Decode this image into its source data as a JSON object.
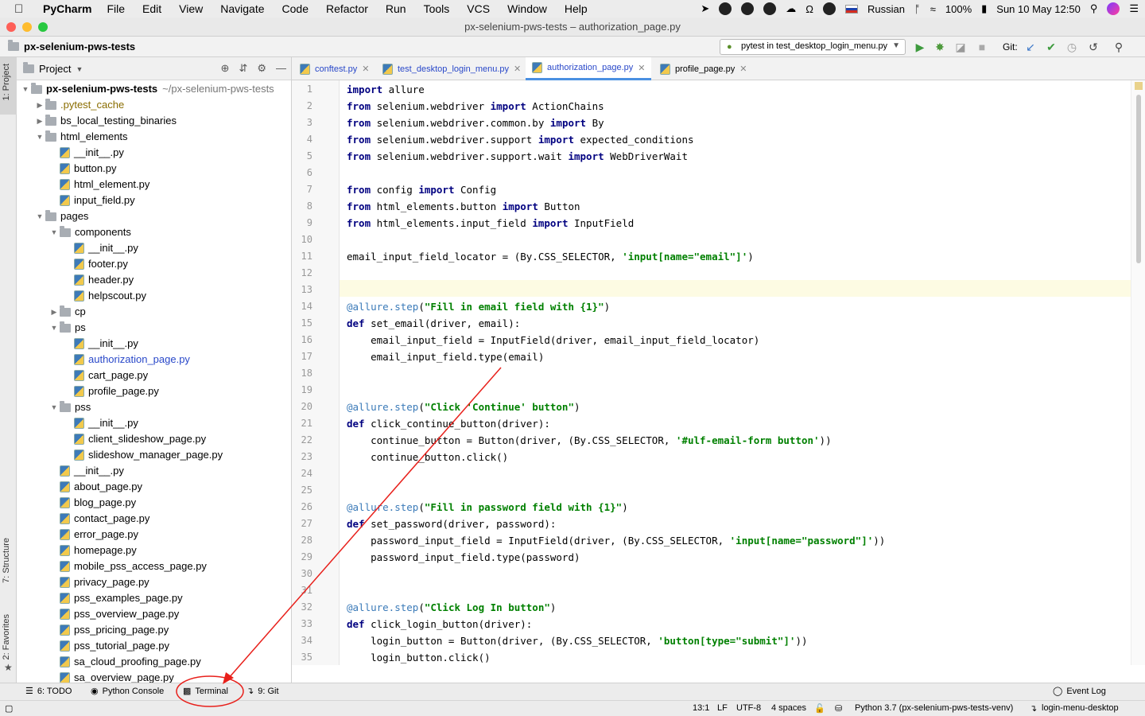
{
  "menubar": {
    "app": "PyCharm",
    "items": [
      "File",
      "Edit",
      "View",
      "Navigate",
      "Code",
      "Refactor",
      "Run",
      "Tools",
      "VCS",
      "Window",
      "Help"
    ],
    "input_source": "Russian",
    "battery": "100%",
    "clock": "Sun 10 May  12:50"
  },
  "window": {
    "title": "px-selenium-pws-tests – authorization_page.py"
  },
  "navbar": {
    "project": "px-selenium-pws-tests",
    "run_config": "pytest in test_desktop_login_menu.py",
    "git_label": "Git:"
  },
  "side_tabs": {
    "project": "1: Project",
    "structure": "7: Structure",
    "favorites": "2: Favorites"
  },
  "project_panel": {
    "header": "Project",
    "tree": [
      {
        "label": "px-selenium-pws-tests",
        "path": "~/px-selenium-pws-tests",
        "depth": 0,
        "kind": "root",
        "expanded": true
      },
      {
        "label": ".pytest_cache",
        "depth": 1,
        "kind": "folder",
        "expanded": false,
        "color": "#8a6d00"
      },
      {
        "label": "bs_local_testing_binaries",
        "depth": 1,
        "kind": "folder",
        "expanded": false
      },
      {
        "label": "html_elements",
        "depth": 1,
        "kind": "package",
        "expanded": true
      },
      {
        "label": "__init__.py",
        "depth": 2,
        "kind": "py"
      },
      {
        "label": "button.py",
        "depth": 2,
        "kind": "py"
      },
      {
        "label": "html_element.py",
        "depth": 2,
        "kind": "py"
      },
      {
        "label": "input_field.py",
        "depth": 2,
        "kind": "py"
      },
      {
        "label": "pages",
        "depth": 1,
        "kind": "package",
        "expanded": true
      },
      {
        "label": "components",
        "depth": 2,
        "kind": "package",
        "expanded": true
      },
      {
        "label": "__init__.py",
        "depth": 3,
        "kind": "py"
      },
      {
        "label": "footer.py",
        "depth": 3,
        "kind": "py"
      },
      {
        "label": "header.py",
        "depth": 3,
        "kind": "py"
      },
      {
        "label": "helpscout.py",
        "depth": 3,
        "kind": "py"
      },
      {
        "label": "cp",
        "depth": 2,
        "kind": "package",
        "expanded": false
      },
      {
        "label": "ps",
        "depth": 2,
        "kind": "package",
        "expanded": true
      },
      {
        "label": "__init__.py",
        "depth": 3,
        "kind": "py"
      },
      {
        "label": "authorization_page.py",
        "depth": 3,
        "kind": "py",
        "color": "#2948c9"
      },
      {
        "label": "cart_page.py",
        "depth": 3,
        "kind": "py"
      },
      {
        "label": "profile_page.py",
        "depth": 3,
        "kind": "py"
      },
      {
        "label": "pss",
        "depth": 2,
        "kind": "package",
        "expanded": true
      },
      {
        "label": "__init__.py",
        "depth": 3,
        "kind": "py"
      },
      {
        "label": "client_slideshow_page.py",
        "depth": 3,
        "kind": "py"
      },
      {
        "label": "slideshow_manager_page.py",
        "depth": 3,
        "kind": "py"
      },
      {
        "label": "__init__.py",
        "depth": 2,
        "kind": "py"
      },
      {
        "label": "about_page.py",
        "depth": 2,
        "kind": "py"
      },
      {
        "label": "blog_page.py",
        "depth": 2,
        "kind": "py"
      },
      {
        "label": "contact_page.py",
        "depth": 2,
        "kind": "py"
      },
      {
        "label": "error_page.py",
        "depth": 2,
        "kind": "py"
      },
      {
        "label": "homepage.py",
        "depth": 2,
        "kind": "py"
      },
      {
        "label": "mobile_pss_access_page.py",
        "depth": 2,
        "kind": "py"
      },
      {
        "label": "privacy_page.py",
        "depth": 2,
        "kind": "py"
      },
      {
        "label": "pss_examples_page.py",
        "depth": 2,
        "kind": "py"
      },
      {
        "label": "pss_overview_page.py",
        "depth": 2,
        "kind": "py"
      },
      {
        "label": "pss_pricing_page.py",
        "depth": 2,
        "kind": "py"
      },
      {
        "label": "pss_tutorial_page.py",
        "depth": 2,
        "kind": "py"
      },
      {
        "label": "sa_cloud_proofing_page.py",
        "depth": 2,
        "kind": "py"
      },
      {
        "label": "sa_overview_page.py",
        "depth": 2,
        "kind": "py"
      }
    ]
  },
  "tabs": [
    {
      "label": "conftest.py",
      "active": false
    },
    {
      "label": "test_desktop_login_menu.py",
      "active": false
    },
    {
      "label": "authorization_page.py",
      "active": true
    },
    {
      "label": "profile_page.py",
      "active": false
    }
  ],
  "editor": {
    "current_line": 13,
    "lines": [
      [
        [
          "k",
          "import"
        ],
        [
          "t",
          " allure"
        ]
      ],
      [
        [
          "k",
          "from"
        ],
        [
          "t",
          " selenium.webdriver "
        ],
        [
          "k",
          "import"
        ],
        [
          "t",
          " ActionChains"
        ]
      ],
      [
        [
          "k",
          "from"
        ],
        [
          "t",
          " selenium.webdriver.common.by "
        ],
        [
          "k",
          "import"
        ],
        [
          "t",
          " By"
        ]
      ],
      [
        [
          "k",
          "from"
        ],
        [
          "t",
          " selenium.webdriver.support "
        ],
        [
          "k",
          "import"
        ],
        [
          "t",
          " expected_conditions"
        ]
      ],
      [
        [
          "k",
          "from"
        ],
        [
          "t",
          " selenium.webdriver.support.wait "
        ],
        [
          "k",
          "import"
        ],
        [
          "t",
          " WebDriverWait"
        ]
      ],
      [],
      [
        [
          "k",
          "from"
        ],
        [
          "t",
          " config "
        ],
        [
          "k",
          "import"
        ],
        [
          "t",
          " Config"
        ]
      ],
      [
        [
          "k",
          "from"
        ],
        [
          "t",
          " html_elements.button "
        ],
        [
          "k",
          "import"
        ],
        [
          "t",
          " Button"
        ]
      ],
      [
        [
          "k",
          "from"
        ],
        [
          "t",
          " html_elements.input_field "
        ],
        [
          "k",
          "import"
        ],
        [
          "t",
          " InputField"
        ]
      ],
      [],
      [
        [
          "t",
          "email_input_field_locator = (By.CSS_SELECTOR, "
        ],
        [
          "s",
          "'input[name=\"email\"]'"
        ],
        [
          "t",
          ")"
        ]
      ],
      [],
      [],
      [
        [
          "d",
          "@allure.step"
        ],
        [
          "t",
          "("
        ],
        [
          "s",
          "\"Fill in email field with {1}\""
        ],
        [
          "t",
          ")"
        ]
      ],
      [
        [
          "k",
          "def"
        ],
        [
          "t",
          " set_email(driver, email):"
        ]
      ],
      [
        [
          "t",
          "    email_input_field = InputField(driver, email_input_field_locator)"
        ]
      ],
      [
        [
          "t",
          "    email_input_field.type(email)"
        ]
      ],
      [],
      [],
      [
        [
          "d",
          "@allure.step"
        ],
        [
          "t",
          "("
        ],
        [
          "s",
          "\"Click 'Continue' button\""
        ],
        [
          "t",
          ")"
        ]
      ],
      [
        [
          "k",
          "def"
        ],
        [
          "t",
          " click_continue_button(driver):"
        ]
      ],
      [
        [
          "t",
          "    continue_button = Button(driver, (By.CSS_SELECTOR, "
        ],
        [
          "s",
          "'#ulf-email-form button'"
        ],
        [
          "t",
          "))"
        ]
      ],
      [
        [
          "t",
          "    continue_button.click()"
        ]
      ],
      [],
      [],
      [
        [
          "d",
          "@allure.step"
        ],
        [
          "t",
          "("
        ],
        [
          "s",
          "\"Fill in password field with {1}\""
        ],
        [
          "t",
          ")"
        ]
      ],
      [
        [
          "k",
          "def"
        ],
        [
          "t",
          " set_password(driver, password):"
        ]
      ],
      [
        [
          "t",
          "    password_input_field = InputField(driver, (By.CSS_SELECTOR, "
        ],
        [
          "s",
          "'input[name=\"password\"]'"
        ],
        [
          "t",
          "))"
        ]
      ],
      [
        [
          "t",
          "    password_input_field.type(password)"
        ]
      ],
      [],
      [],
      [
        [
          "d",
          "@allure.step"
        ],
        [
          "t",
          "("
        ],
        [
          "s",
          "\"Click Log In button\""
        ],
        [
          "t",
          ")"
        ]
      ],
      [
        [
          "k",
          "def"
        ],
        [
          "t",
          " click_login_button(driver):"
        ]
      ],
      [
        [
          "t",
          "    login_button = Button(driver, (By.CSS_SELECTOR, "
        ],
        [
          "s",
          "'button[type=\"submit\"]'"
        ],
        [
          "t",
          "))"
        ]
      ],
      [
        [
          "t",
          "    login_button.click()"
        ]
      ]
    ]
  },
  "tool_windows": {
    "todo": "6: TODO",
    "python_console": "Python Console",
    "terminal": "Terminal",
    "git": "9: Git",
    "event_log": "Event Log"
  },
  "status": {
    "position": "13:1",
    "line_sep": "LF",
    "encoding": "UTF-8",
    "indent": "4 spaces",
    "interpreter": "Python 3.7 (px-selenium-pws-tests-venv)",
    "branch": "login-menu-desktop"
  },
  "colors": {
    "annotation": "#e8201b",
    "keyword": "#000080",
    "string": "#008000",
    "decorator": "#3a7ab8",
    "link_file": "#2948c9"
  }
}
